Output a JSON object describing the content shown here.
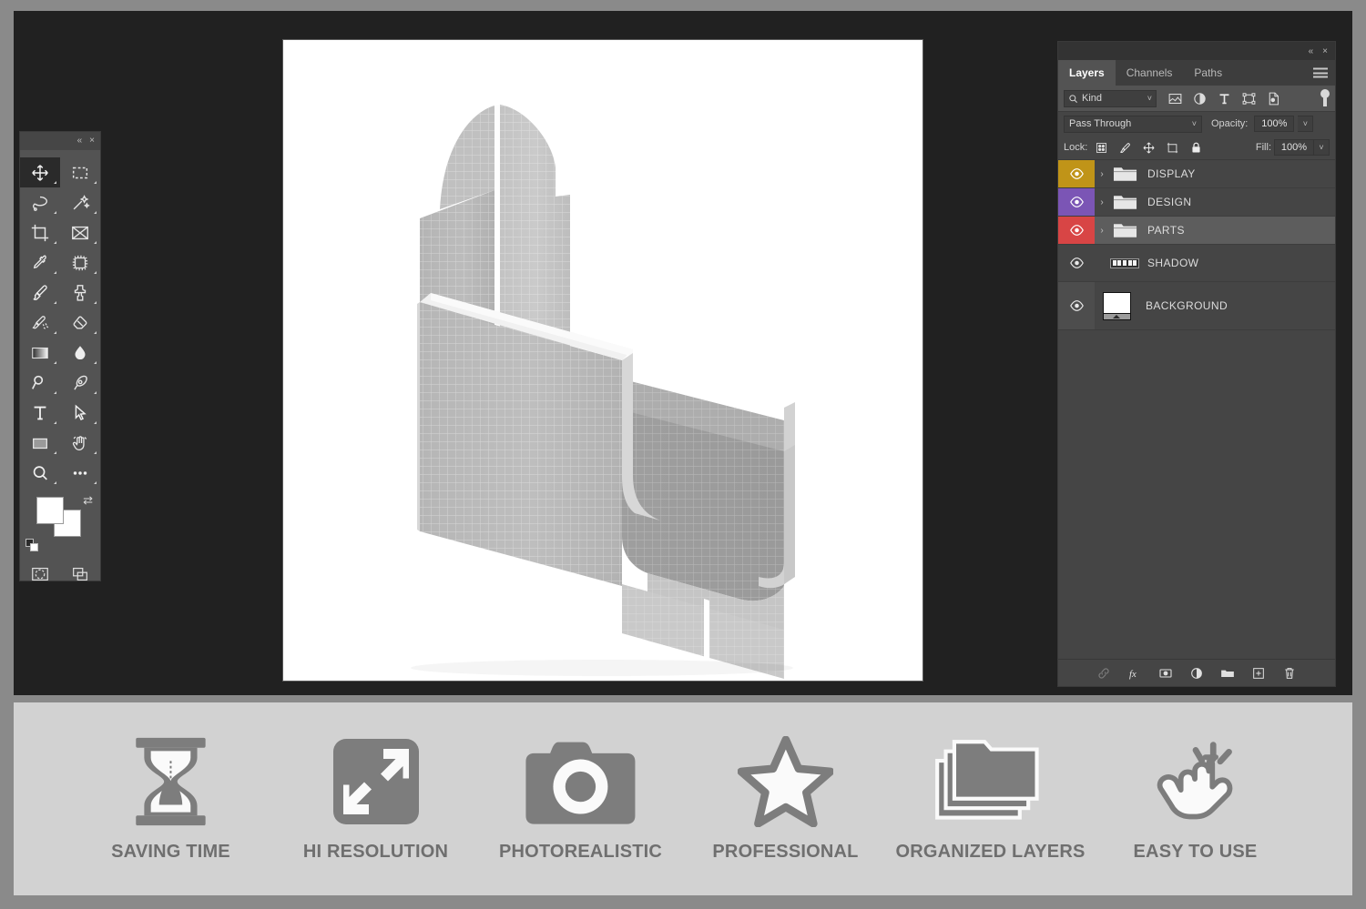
{
  "theme": {
    "frame_color": "#8a8a8a",
    "workspace_bg": "#212121",
    "panel_bg": "#454545",
    "panel_header_bg": "#333333",
    "feature_bar_bg": "#d2d2d2",
    "feature_icon_color": "#7d7d7d",
    "feature_label_color": "#6f6f6f"
  },
  "tools_panel": {
    "collapse_label": "«",
    "close_label": "×",
    "tools": [
      {
        "name": "move-tool",
        "active": true
      },
      {
        "name": "rectangular-marquee-tool",
        "active": false
      },
      {
        "name": "lasso-tool",
        "active": false
      },
      {
        "name": "magic-wand-tool",
        "active": false
      },
      {
        "name": "crop-tool",
        "active": false
      },
      {
        "name": "frame-tool",
        "active": false
      },
      {
        "name": "eyedropper-tool",
        "active": false
      },
      {
        "name": "spot-healing-brush-tool",
        "active": false
      },
      {
        "name": "brush-tool",
        "active": false
      },
      {
        "name": "clone-stamp-tool",
        "active": false
      },
      {
        "name": "history-brush-tool",
        "active": false
      },
      {
        "name": "eraser-tool",
        "active": false
      },
      {
        "name": "gradient-tool",
        "active": false
      },
      {
        "name": "blur-tool",
        "active": false
      },
      {
        "name": "dodge-tool",
        "active": false
      },
      {
        "name": "pen-tool",
        "active": false
      },
      {
        "name": "horizontal-type-tool",
        "active": false
      },
      {
        "name": "path-selection-tool",
        "active": false
      },
      {
        "name": "rectangle-tool",
        "active": false
      },
      {
        "name": "hand-tool",
        "active": false
      },
      {
        "name": "zoom-tool",
        "active": false
      },
      {
        "name": "edit-toolbar-tool",
        "active": false
      }
    ],
    "bottom_tools": [
      {
        "name": "quick-mask-mode"
      },
      {
        "name": "screen-mode"
      }
    ],
    "swatches": {
      "foreground": "#ffffff",
      "background": "#ffffff"
    }
  },
  "layers_panel": {
    "titlebar": {
      "collapse_label": "«",
      "close_label": "×"
    },
    "tabs": [
      {
        "label": "Layers",
        "active": true
      },
      {
        "label": "Channels",
        "active": false
      },
      {
        "label": "Paths",
        "active": false
      }
    ],
    "menu_icon": "hamburger-menu-icon",
    "filter": {
      "search_icon": "search-icon",
      "kind_label": "Kind",
      "chevron": "˅",
      "icons": [
        "pixel-layer-filter-icon",
        "adjustment-layer-filter-icon",
        "type-layer-filter-icon",
        "shape-layer-filter-icon",
        "smart-object-filter-icon"
      ],
      "toggle_name": "filter-enable-toggle"
    },
    "blend": {
      "mode": "Pass Through",
      "chevron": "˅",
      "opacity_label": "Opacity:",
      "opacity_value": "100%"
    },
    "lock": {
      "label": "Lock:",
      "icons": [
        "lock-transparent-pixels-icon",
        "lock-image-pixels-icon",
        "lock-position-icon",
        "lock-artboard-nesting-icon",
        "lock-all-icon"
      ],
      "fill_label": "Fill:",
      "fill_value": "100%"
    },
    "layers": [
      {
        "name": "DISPLAY",
        "type": "group",
        "color": "#c09418",
        "visible": true,
        "selected": false,
        "expanded": false
      },
      {
        "name": "DESIGN",
        "type": "group",
        "color": "#7b55b5",
        "visible": true,
        "selected": false,
        "expanded": false
      },
      {
        "name": "PARTS",
        "type": "group",
        "color": "#d84545",
        "visible": true,
        "selected": true,
        "expanded": false
      },
      {
        "name": "SHADOW",
        "type": "pixel",
        "color": "",
        "visible": true,
        "selected": false,
        "expanded": false
      },
      {
        "name": "BACKGROUND",
        "type": "background",
        "color": "",
        "visible": true,
        "selected": false,
        "expanded": false
      }
    ],
    "footer_icons": [
      "link-layers-icon",
      "add-layer-style-icon",
      "add-layer-mask-icon",
      "new-adjustment-layer-icon",
      "new-group-icon",
      "new-layer-icon",
      "delete-layer-icon"
    ]
  },
  "canvas": {
    "artwork_name": "brochure-holder-3d-mockup",
    "background": "#ffffff"
  },
  "feature_bar": {
    "features": [
      {
        "icon": "hourglass-icon",
        "label": "SAVING TIME"
      },
      {
        "icon": "resize-arrows-icon",
        "label": "HI RESOLUTION"
      },
      {
        "icon": "camera-icon",
        "label": "PHOTOREALISTIC"
      },
      {
        "icon": "star-icon",
        "label": "PROFESSIONAL"
      },
      {
        "icon": "stacked-folders-icon",
        "label": "ORGANIZED LAYERS"
      },
      {
        "icon": "pointing-hand-tap-icon",
        "label": "EASY TO USE"
      }
    ]
  }
}
